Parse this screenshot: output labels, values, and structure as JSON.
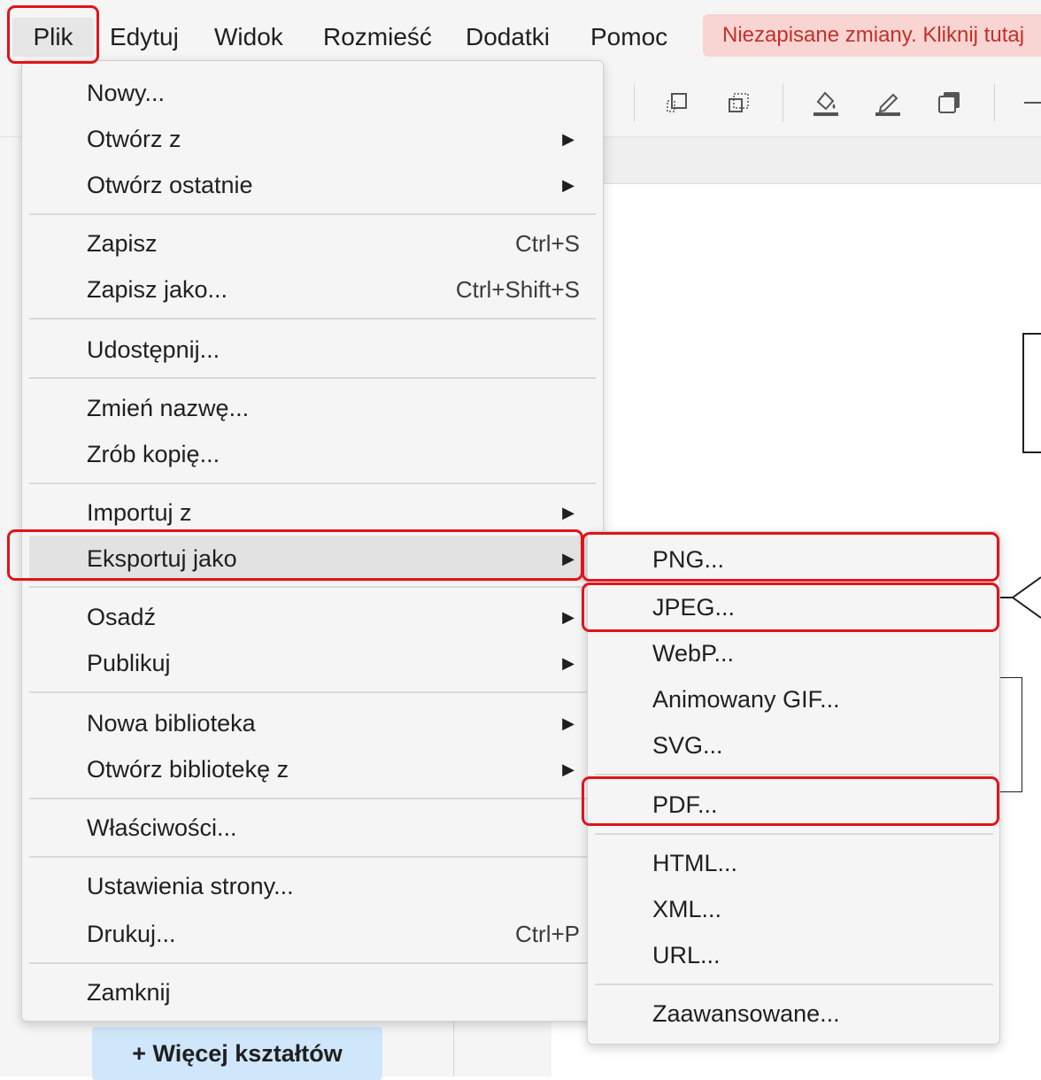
{
  "menubar": {
    "items": [
      {
        "label": "Plik"
      },
      {
        "label": "Edytuj"
      },
      {
        "label": "Widok"
      },
      {
        "label": "Rozmieść"
      },
      {
        "label": "Dodatki"
      },
      {
        "label": "Pomoc"
      }
    ],
    "unsaved_banner": "Niezapisane zmiany. Kliknij tutaj"
  },
  "toolbar": {
    "icons": [
      "to-front-icon",
      "to-back-icon",
      "fill-color-icon",
      "line-color-icon",
      "shadow-icon",
      "line-icon"
    ]
  },
  "sidebar": {
    "more_shapes": "+ Więcej kształtów"
  },
  "file_menu": {
    "items": [
      {
        "label": "Nowy...",
        "shortcut": "",
        "submenu": false
      },
      {
        "label": "Otwórz z",
        "shortcut": "",
        "submenu": true
      },
      {
        "label": "Otwórz ostatnie",
        "shortcut": "",
        "submenu": true
      },
      {
        "label": "Zapisz",
        "shortcut": "Ctrl+S",
        "submenu": false
      },
      {
        "label": "Zapisz jako...",
        "shortcut": "Ctrl+Shift+S",
        "submenu": false
      },
      {
        "label": "Udostępnij...",
        "shortcut": "",
        "submenu": false
      },
      {
        "label": "Zmień nazwę...",
        "shortcut": "",
        "submenu": false
      },
      {
        "label": "Zrób kopię...",
        "shortcut": "",
        "submenu": false
      },
      {
        "label": "Importuj z",
        "shortcut": "",
        "submenu": true
      },
      {
        "label": "Eksportuj jako",
        "shortcut": "",
        "submenu": true
      },
      {
        "label": "Osadź",
        "shortcut": "",
        "submenu": true
      },
      {
        "label": "Publikuj",
        "shortcut": "",
        "submenu": true
      },
      {
        "label": "Nowa biblioteka",
        "shortcut": "",
        "submenu": true
      },
      {
        "label": "Otwórz bibliotekę z",
        "shortcut": "",
        "submenu": true
      },
      {
        "label": "Właściwości...",
        "shortcut": "",
        "submenu": false
      },
      {
        "label": "Ustawienia strony...",
        "shortcut": "",
        "submenu": false
      },
      {
        "label": "Drukuj...",
        "shortcut": "Ctrl+P",
        "submenu": false
      },
      {
        "label": "Zamknij",
        "shortcut": "",
        "submenu": false
      }
    ]
  },
  "export_menu": {
    "items": [
      {
        "label": "PNG..."
      },
      {
        "label": "JPEG..."
      },
      {
        "label": "WebP..."
      },
      {
        "label": "Animowany GIF..."
      },
      {
        "label": "SVG..."
      },
      {
        "label": "PDF..."
      },
      {
        "label": "HTML..."
      },
      {
        "label": "XML..."
      },
      {
        "label": "URL..."
      },
      {
        "label": "Zaawansowane..."
      }
    ]
  },
  "highlight_color": "#e0141a"
}
